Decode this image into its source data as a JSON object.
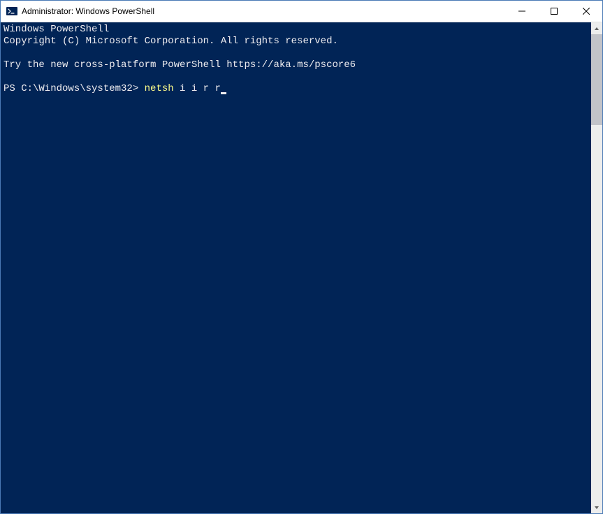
{
  "window": {
    "title": "Administrator: Windows PowerShell"
  },
  "terminal": {
    "header_line1": "Windows PowerShell",
    "header_line2": "Copyright (C) Microsoft Corporation. All rights reserved.",
    "tip_line": "Try the new cross-platform PowerShell https://aka.ms/pscore6",
    "prompt": "PS C:\\Windows\\system32> ",
    "command": "netsh",
    "args": " i i r r"
  },
  "icons": {
    "app": "powershell-icon",
    "minimize": "minimize-icon",
    "maximize": "maximize-icon",
    "close": "close-icon",
    "scroll_up": "scroll-up-icon",
    "scroll_down": "scroll-down-icon"
  }
}
